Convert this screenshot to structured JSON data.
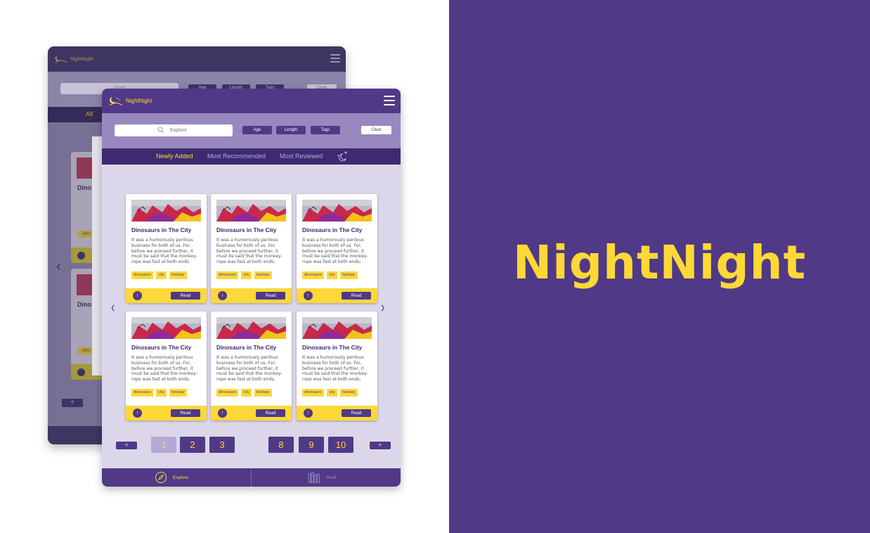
{
  "brand": {
    "title": "NightNight"
  },
  "app": {
    "logo_text": "NightNight",
    "search_placeholder": "Explore",
    "filters": [
      "Age",
      "Length",
      "Tags"
    ],
    "clear_label": "Clear",
    "tabs": [
      {
        "label": "Newly Added",
        "active": true
      },
      {
        "label": "Most Recommended",
        "active": false
      },
      {
        "label": "Most Reviewed",
        "active": false
      }
    ],
    "cards": [
      {
        "title": "Dinosaurs in The City",
        "description": "It was a humorously perilous business for both of us. For, before we proceed further, it must be said that the monkey-rope was fast at both ends;",
        "tags": [
          "dinosaurs",
          "city",
          "fantasy"
        ],
        "info": "i",
        "read_label": "Read"
      },
      {
        "title": "Dinosaurs in The City",
        "description": "It was a humorously perilous business for both of us. For, before we proceed further, it must be said that the monkey-rope was fast at both ends;",
        "tags": [
          "dinosaurs",
          "city",
          "fantasy"
        ],
        "info": "i",
        "read_label": "Read"
      },
      {
        "title": "Dinosaurs in The City",
        "description": "It was a humorously perilous business for both of us. For, before we proceed further, it must be said that the monkey-rope was fast at both ends;",
        "tags": [
          "dinosaurs",
          "city",
          "fantasy"
        ],
        "info": "i",
        "read_label": "Read"
      },
      {
        "title": "Dinosaurs in The City",
        "description": "It was a humorously perilous business for both of us. For, before we proceed further, it must be said that the monkey-rope was fast at both ends;",
        "tags": [
          "dinosaurs",
          "city",
          "fantasy"
        ],
        "info": "i",
        "read_label": "Read"
      },
      {
        "title": "Dinosaurs in The City",
        "description": "It was a humorously perilous business for both of us. For, before we proceed further, it must be said that the monkey-rope was fast at both ends;",
        "tags": [
          "dinosaurs",
          "city",
          "fantasy"
        ],
        "info": "i",
        "read_label": "Read"
      },
      {
        "title": "Dinosaurs in The City",
        "description": "It was a humorously perilous business for both of us. For, before we proceed further, it must be said that the monkey-rope was fast at both ends;",
        "tags": [
          "dinosaurs",
          "city",
          "fantasy"
        ],
        "info": "i",
        "read_label": "Read"
      }
    ],
    "pagination": {
      "prev": "<",
      "next": ">",
      "pages": [
        "1",
        "2",
        "3",
        "8",
        "9",
        "10"
      ],
      "current": "1",
      "ellipsis": "..."
    },
    "bottom_nav": [
      {
        "label": "Explore",
        "icon": "compass-icon",
        "active": true
      },
      {
        "label": "Shelf",
        "icon": "books-icon",
        "active": false
      }
    ]
  },
  "back_screen": {
    "logo_text": "NightNight",
    "search_placeholder": "Shelf",
    "filters": [
      "Age",
      "Length",
      "Tags"
    ],
    "clear_label": "Clear",
    "tab_all": "All",
    "card_title_fragment": "Dino",
    "tag_fragment": "dino",
    "prev": "<"
  },
  "colors": {
    "purple": "#503986",
    "yellow": "#fed836",
    "lavender": "#dcd6ea",
    "dark_purple": "#3d2a72"
  }
}
